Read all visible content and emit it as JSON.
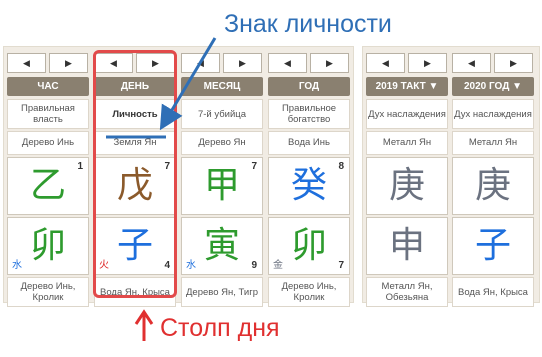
{
  "annotations": {
    "title": "Знак личности",
    "pillar": "Столп дня"
  },
  "colors": {
    "wood": "#2e9b2e",
    "earth": "#8b5a2b",
    "water": "#1e6fdd",
    "metal": "#6b7280",
    "fire": "#dd2222",
    "header_bg": "#8a8070"
  },
  "nav": {
    "prev": "◀",
    "next": "▶"
  },
  "pillars": [
    {
      "header": "ЧАС",
      "role": "Правильная власть",
      "stem_element": "Дерево Инь",
      "stem": "乙",
      "stem_color": "wood",
      "stem_num": "1",
      "branch": "卯",
      "branch_color": "wood",
      "branch_num": "",
      "branch_small": "水",
      "branch_small_color": "water",
      "bottom": "Дерево Инь, Кролик"
    },
    {
      "header": "ДЕНЬ",
      "role": "Личность",
      "stem_element": "Земля Ян",
      "stem": "戊",
      "stem_color": "earth",
      "stem_num": "7",
      "branch": "子",
      "branch_color": "water",
      "branch_num": "4",
      "branch_small": "火",
      "branch_small_color": "fire",
      "bottom": "Вода Ян, Крыса"
    },
    {
      "header": "МЕСЯЦ",
      "role": "7-й убийца",
      "stem_element": "Дерево Ян",
      "stem": "甲",
      "stem_color": "wood",
      "stem_num": "7",
      "branch": "寅",
      "branch_color": "wood",
      "branch_num": "9",
      "branch_small": "水",
      "branch_small_color": "water",
      "bottom": "Дерево Ян, Тигр"
    },
    {
      "header": "ГОД",
      "role": "Правильное богатство",
      "stem_element": "Вода Инь",
      "stem": "癸",
      "stem_color": "water",
      "stem_num": "8",
      "branch": "卯",
      "branch_color": "wood",
      "branch_num": "7",
      "branch_small": "金",
      "branch_small_color": "metal",
      "bottom": "Дерево Инь, Кролик"
    }
  ],
  "luck": [
    {
      "header": "2019 ТАКТ ▼",
      "role": "Дух наслаждения",
      "stem_element": "Металл Ян",
      "stem": "庚",
      "stem_color": "metal",
      "branch": "申",
      "branch_color": "metal",
      "bottom": "Металл Ян, Обезьяна"
    },
    {
      "header": "2020 ГОД ▼",
      "role": "Дух наслаждения",
      "stem_element": "Металл Ян",
      "stem": "庚",
      "stem_color": "metal",
      "branch": "子",
      "branch_color": "water",
      "bottom": "Вода Ян, Крыса"
    }
  ]
}
